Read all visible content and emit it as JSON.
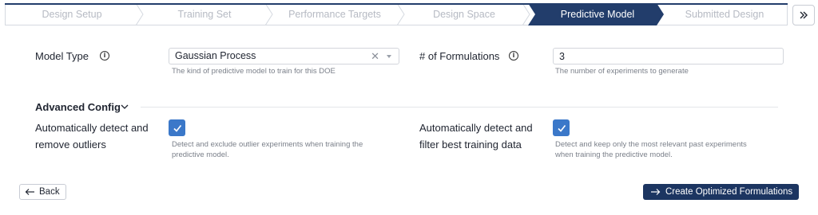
{
  "stepper": {
    "steps": [
      {
        "label": "Design Setup",
        "active": false
      },
      {
        "label": "Training Set",
        "active": false
      },
      {
        "label": "Performance Targets",
        "active": false
      },
      {
        "label": "Design Space",
        "active": false
      },
      {
        "label": "Predictive Model",
        "active": true
      },
      {
        "label": "Submitted Design",
        "active": false
      }
    ],
    "collapse_icon": "double-chevron-right-icon",
    "colors": {
      "active": "#223d6b",
      "inactive": "#ffffff",
      "border": "#d5d9e0",
      "top_bar": "#223d6b"
    }
  },
  "form": {
    "model_type": {
      "label": "Model Type",
      "value": "Gaussian Process",
      "help": "The kind of predictive model to train for this DOE"
    },
    "formulations": {
      "label": "# of Formulations",
      "value": "3",
      "help": "The number of experiments to generate"
    },
    "advanced": {
      "title": "Advanced Config",
      "outliers": {
        "label_line1": "Automatically detect and",
        "label_line2": "remove outliers",
        "checked": true,
        "help_line1": "Detect and exclude outlier experiments when training the",
        "help_line2": "predictive model."
      },
      "training": {
        "label_line1": "Automatically detect and",
        "label_line2": "filter best training data",
        "checked": true,
        "help_line1": "Detect and keep only the most relevant past experiments",
        "help_line2": "when training the predictive model."
      }
    }
  },
  "actions": {
    "back_label": "Back",
    "create_label": "Create Optimized Formulations",
    "primary_color": "#1c3561",
    "checkbox_color": "#3b78c9"
  }
}
